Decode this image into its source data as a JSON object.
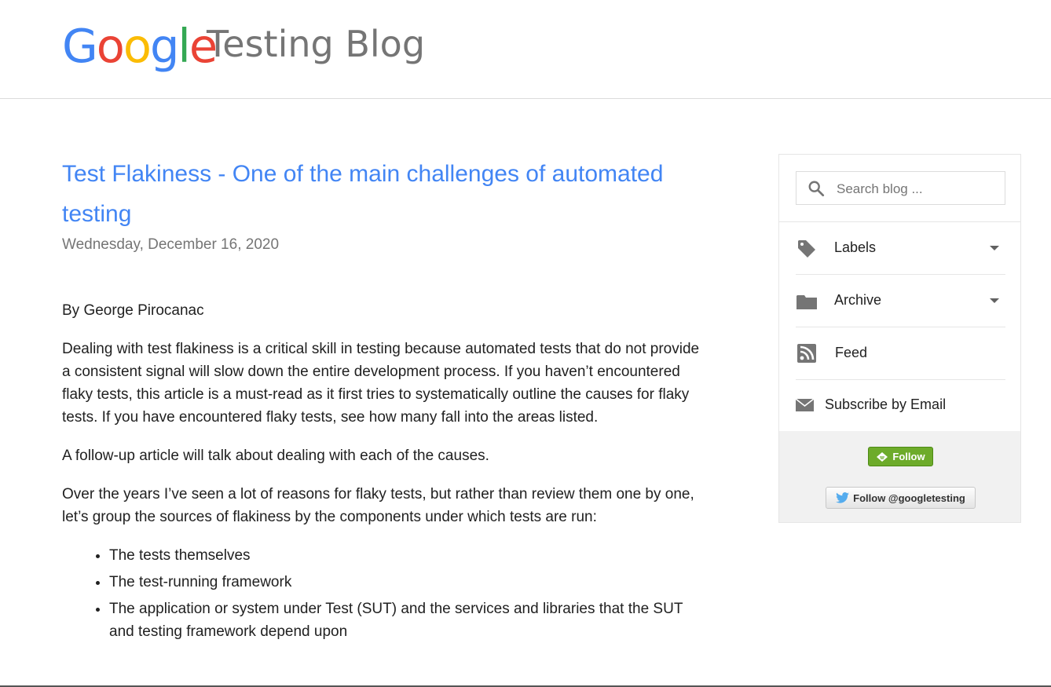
{
  "header": {
    "logo_letters": [
      "G",
      "o",
      "o",
      "g",
      "l",
      "e"
    ],
    "logo_colors": [
      "#4285f4",
      "#ea4335",
      "#fbbc05",
      "#4285f4",
      "#34a853",
      "#ea4335"
    ],
    "blog_title": "Testing Blog"
  },
  "post": {
    "title": "Test Flakiness - One of the main challenges of automated testing",
    "date": "Wednesday, December 16, 2020",
    "byline": "By George Pirocanac",
    "paragraphs": [
      "Dealing with test flakiness is a critical skill in testing because automated tests that do not provide a consistent signal will slow down the entire development process. If you haven’t encountered flaky tests, this article is a must-read as it first tries to systematically outline the causes for flaky tests. If you have encountered flaky tests, see how many fall into the areas listed.",
      "A follow-up article will talk about dealing with each of the causes.",
      "Over the years I’ve seen a lot of reasons for flaky tests, but rather than review them one by one, let’s group the sources of flakiness by the components under which tests are run:"
    ],
    "list_items": [
      "The tests themselves",
      "The test-running framework",
      "The application or system under Test (SUT) and the services and libraries that the SUT and testing framework depend upon"
    ],
    "title_color": "#4285f4"
  },
  "sidebar": {
    "search_placeholder": "Search blog ...",
    "items": [
      {
        "label": "Labels",
        "icon": "tag-icon"
      },
      {
        "label": "Archive",
        "icon": "folder-icon"
      },
      {
        "label": "Feed",
        "icon": "rss-icon"
      },
      {
        "label": "Subscribe by Email",
        "icon": "email-icon"
      }
    ],
    "follow_label": "Follow",
    "twitter_label": "Follow @googletesting"
  }
}
